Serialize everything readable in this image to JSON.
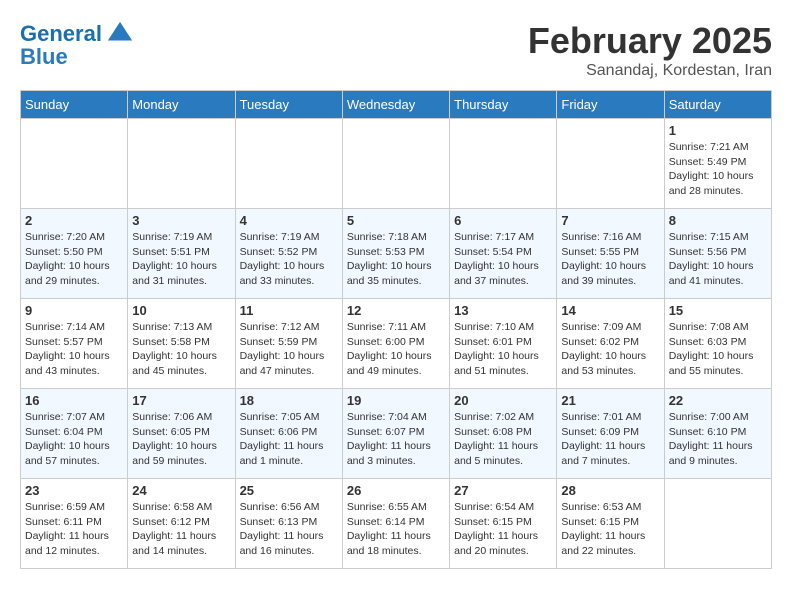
{
  "header": {
    "logo_line1": "General",
    "logo_line2": "Blue",
    "month_year": "February 2025",
    "location": "Sanandaj, Kordestan, Iran"
  },
  "days_of_week": [
    "Sunday",
    "Monday",
    "Tuesday",
    "Wednesday",
    "Thursday",
    "Friday",
    "Saturday"
  ],
  "weeks": [
    [
      {
        "day": "",
        "info": ""
      },
      {
        "day": "",
        "info": ""
      },
      {
        "day": "",
        "info": ""
      },
      {
        "day": "",
        "info": ""
      },
      {
        "day": "",
        "info": ""
      },
      {
        "day": "",
        "info": ""
      },
      {
        "day": "1",
        "info": "Sunrise: 7:21 AM\nSunset: 5:49 PM\nDaylight: 10 hours and 28 minutes."
      }
    ],
    [
      {
        "day": "2",
        "info": "Sunrise: 7:20 AM\nSunset: 5:50 PM\nDaylight: 10 hours and 29 minutes."
      },
      {
        "day": "3",
        "info": "Sunrise: 7:19 AM\nSunset: 5:51 PM\nDaylight: 10 hours and 31 minutes."
      },
      {
        "day": "4",
        "info": "Sunrise: 7:19 AM\nSunset: 5:52 PM\nDaylight: 10 hours and 33 minutes."
      },
      {
        "day": "5",
        "info": "Sunrise: 7:18 AM\nSunset: 5:53 PM\nDaylight: 10 hours and 35 minutes."
      },
      {
        "day": "6",
        "info": "Sunrise: 7:17 AM\nSunset: 5:54 PM\nDaylight: 10 hours and 37 minutes."
      },
      {
        "day": "7",
        "info": "Sunrise: 7:16 AM\nSunset: 5:55 PM\nDaylight: 10 hours and 39 minutes."
      },
      {
        "day": "8",
        "info": "Sunrise: 7:15 AM\nSunset: 5:56 PM\nDaylight: 10 hours and 41 minutes."
      }
    ],
    [
      {
        "day": "9",
        "info": "Sunrise: 7:14 AM\nSunset: 5:57 PM\nDaylight: 10 hours and 43 minutes."
      },
      {
        "day": "10",
        "info": "Sunrise: 7:13 AM\nSunset: 5:58 PM\nDaylight: 10 hours and 45 minutes."
      },
      {
        "day": "11",
        "info": "Sunrise: 7:12 AM\nSunset: 5:59 PM\nDaylight: 10 hours and 47 minutes."
      },
      {
        "day": "12",
        "info": "Sunrise: 7:11 AM\nSunset: 6:00 PM\nDaylight: 10 hours and 49 minutes."
      },
      {
        "day": "13",
        "info": "Sunrise: 7:10 AM\nSunset: 6:01 PM\nDaylight: 10 hours and 51 minutes."
      },
      {
        "day": "14",
        "info": "Sunrise: 7:09 AM\nSunset: 6:02 PM\nDaylight: 10 hours and 53 minutes."
      },
      {
        "day": "15",
        "info": "Sunrise: 7:08 AM\nSunset: 6:03 PM\nDaylight: 10 hours and 55 minutes."
      }
    ],
    [
      {
        "day": "16",
        "info": "Sunrise: 7:07 AM\nSunset: 6:04 PM\nDaylight: 10 hours and 57 minutes."
      },
      {
        "day": "17",
        "info": "Sunrise: 7:06 AM\nSunset: 6:05 PM\nDaylight: 10 hours and 59 minutes."
      },
      {
        "day": "18",
        "info": "Sunrise: 7:05 AM\nSunset: 6:06 PM\nDaylight: 11 hours and 1 minute."
      },
      {
        "day": "19",
        "info": "Sunrise: 7:04 AM\nSunset: 6:07 PM\nDaylight: 11 hours and 3 minutes."
      },
      {
        "day": "20",
        "info": "Sunrise: 7:02 AM\nSunset: 6:08 PM\nDaylight: 11 hours and 5 minutes."
      },
      {
        "day": "21",
        "info": "Sunrise: 7:01 AM\nSunset: 6:09 PM\nDaylight: 11 hours and 7 minutes."
      },
      {
        "day": "22",
        "info": "Sunrise: 7:00 AM\nSunset: 6:10 PM\nDaylight: 11 hours and 9 minutes."
      }
    ],
    [
      {
        "day": "23",
        "info": "Sunrise: 6:59 AM\nSunset: 6:11 PM\nDaylight: 11 hours and 12 minutes."
      },
      {
        "day": "24",
        "info": "Sunrise: 6:58 AM\nSunset: 6:12 PM\nDaylight: 11 hours and 14 minutes."
      },
      {
        "day": "25",
        "info": "Sunrise: 6:56 AM\nSunset: 6:13 PM\nDaylight: 11 hours and 16 minutes."
      },
      {
        "day": "26",
        "info": "Sunrise: 6:55 AM\nSunset: 6:14 PM\nDaylight: 11 hours and 18 minutes."
      },
      {
        "day": "27",
        "info": "Sunrise: 6:54 AM\nSunset: 6:15 PM\nDaylight: 11 hours and 20 minutes."
      },
      {
        "day": "28",
        "info": "Sunrise: 6:53 AM\nSunset: 6:15 PM\nDaylight: 11 hours and 22 minutes."
      },
      {
        "day": "",
        "info": ""
      }
    ]
  ]
}
